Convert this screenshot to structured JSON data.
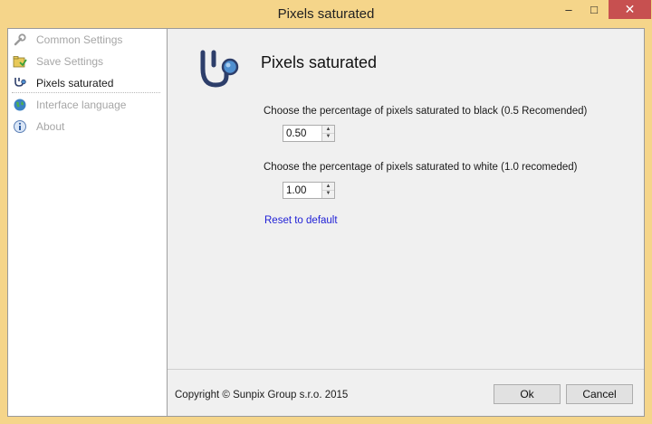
{
  "window": {
    "title": "Pixels saturated",
    "controls": {
      "minimize": "–",
      "maximize": "□",
      "close": "✕"
    }
  },
  "sidebar": {
    "items": [
      {
        "label": "Common Settings",
        "icon": "wrench-icon"
      },
      {
        "label": "Save Settings",
        "icon": "save-folder-icon"
      },
      {
        "label": "Pixels saturated",
        "icon": "stethoscope-icon",
        "active": true
      },
      {
        "label": "Interface language",
        "icon": "globe-icon"
      },
      {
        "label": "About",
        "icon": "info-icon"
      }
    ]
  },
  "main": {
    "title": "Pixels saturated",
    "icon": "stethoscope-icon",
    "black_label": "Choose the percentage of pixels saturated to black (0.5 Recomended)",
    "black_value": "0.50",
    "white_label": "Choose the percentage of pixels saturated to white (1.0 recomeded)",
    "white_value": "1.00",
    "reset_link": "Reset to default"
  },
  "footer": {
    "copyright": "Copyright © Sunpix Group s.r.o. 2015",
    "ok_label": "Ok",
    "cancel_label": "Cancel"
  },
  "colors": {
    "titlebar": "#f5d58a",
    "close_button": "#c75050",
    "link": "#1f1fd6"
  }
}
